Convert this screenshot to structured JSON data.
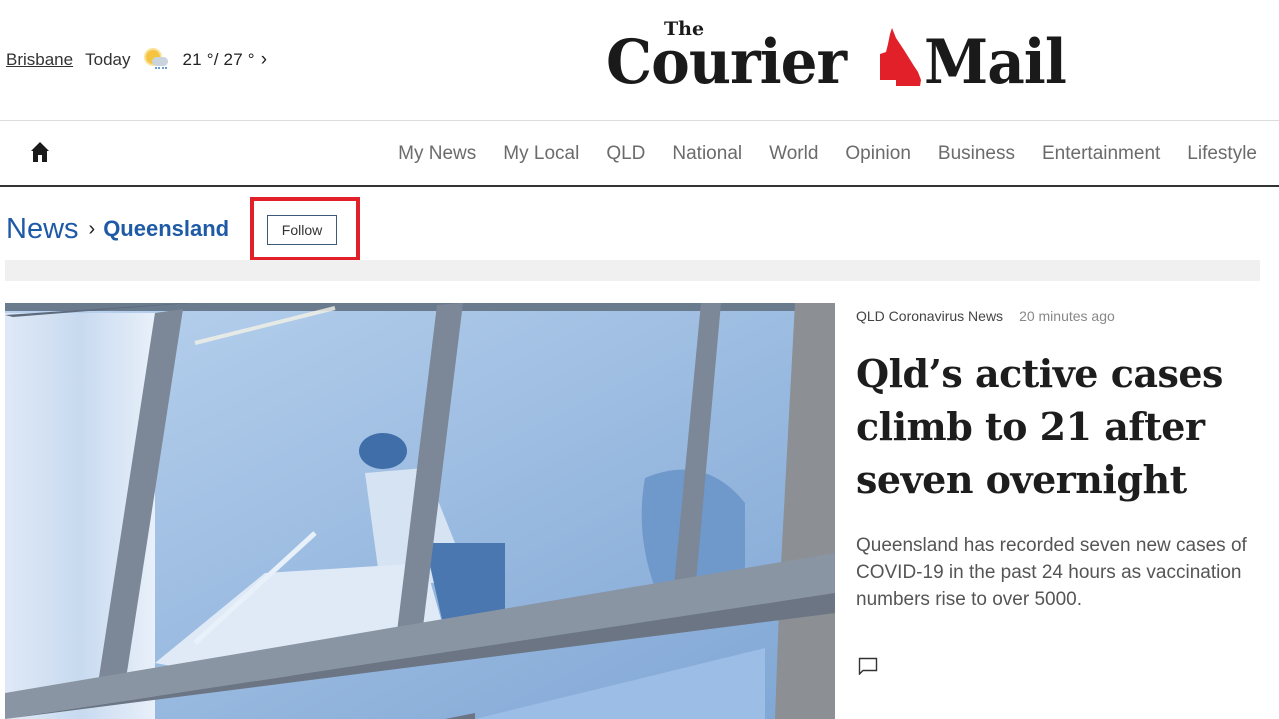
{
  "header": {
    "weather": {
      "city": "Brisbane",
      "day": "Today",
      "icon": "partly-cloudy-rain-icon",
      "temps": "21 °/ 27 °",
      "chevron": "›"
    },
    "logo": {
      "the": "The",
      "left": "Courier",
      "right": "Mail",
      "emblem": "queensland-map-icon",
      "emblem_color": "#e2202a"
    }
  },
  "nav": {
    "home_icon": "home-icon",
    "items": [
      {
        "label": "My News"
      },
      {
        "label": "My Local"
      },
      {
        "label": "QLD"
      },
      {
        "label": "National"
      },
      {
        "label": "World"
      },
      {
        "label": "Opinion"
      },
      {
        "label": "Business"
      },
      {
        "label": "Entertainment"
      },
      {
        "label": "Lifestyle"
      }
    ]
  },
  "breadcrumb": {
    "section": "News",
    "separator": "›",
    "subsection": "Queensland",
    "follow_label": "Follow",
    "highlight_color": "#e2202a",
    "link_color": "#1f5aa6"
  },
  "article": {
    "category": "QLD Coronavirus News",
    "time": "20 minutes ago",
    "headline": "Qld’s active cases climb to 21 after seven overnight",
    "standfirst": "Queensland has recorded seven new cases of COVID-19 in the past 24 hours as vaccination numbers rise to over 5000.",
    "comment_icon": "comment-icon",
    "image_alt": "Worker cleaning a hotel room window"
  }
}
